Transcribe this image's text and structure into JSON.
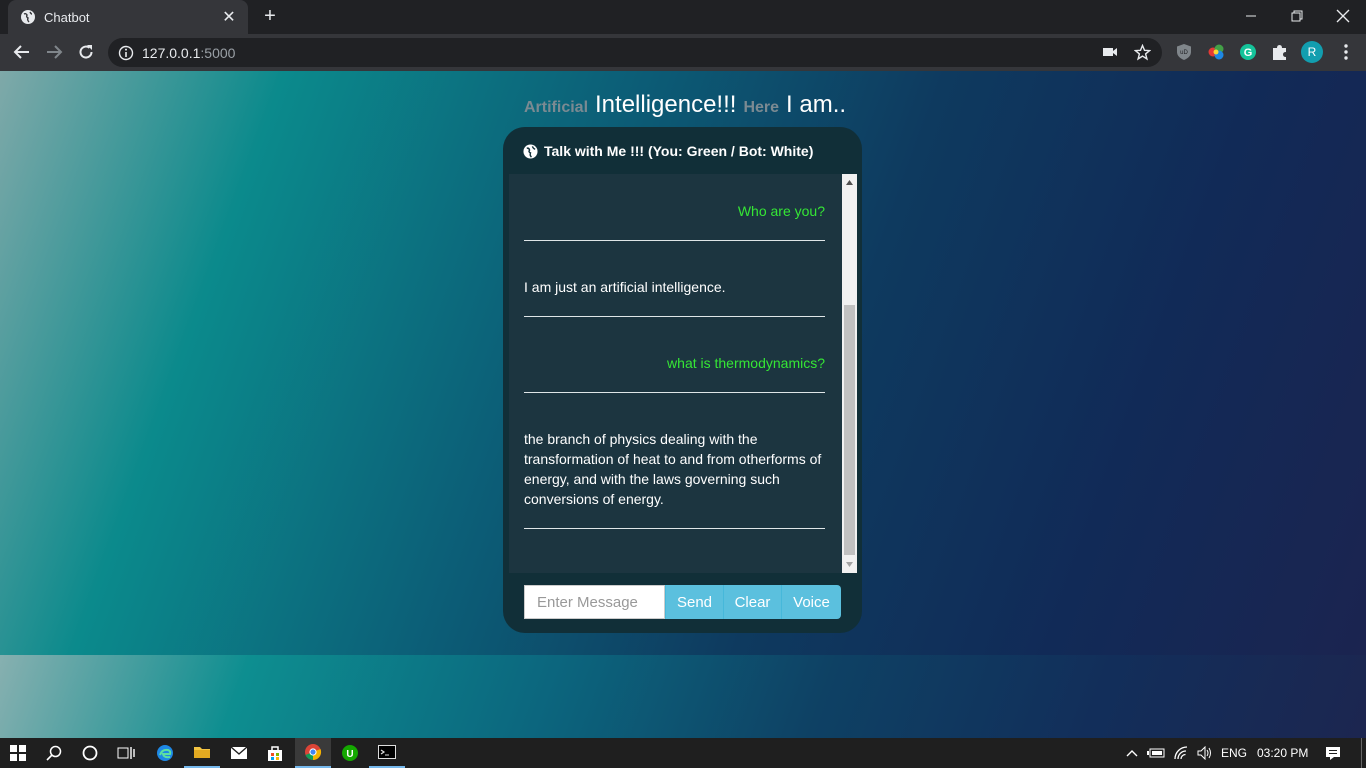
{
  "browser": {
    "tab_title": "Chatbot",
    "url_host": "127.0.0.1",
    "url_port": ":5000",
    "profile_initial": "R"
  },
  "page": {
    "headline": {
      "word1": "Artificial",
      "word2": "Intelligence!!!",
      "word3": "Here",
      "word4": "I am.."
    },
    "chat": {
      "header": "Talk with Me !!! (You: Green / Bot: White)",
      "messages": [
        {
          "sender": "user",
          "text": "Who are you?"
        },
        {
          "sender": "bot",
          "text": "I am just an artificial intelligence."
        },
        {
          "sender": "user",
          "text": "what is thermodynamics?"
        },
        {
          "sender": "bot",
          "text": "the branch of physics dealing with the transformation of heat to and from otherforms of energy, and with the laws governing such conversions of energy."
        }
      ],
      "input_placeholder": "Enter Message",
      "send_label": "Send",
      "clear_label": "Clear",
      "voice_label": "Voice"
    }
  },
  "taskbar": {
    "language": "ENG",
    "time": "03:20 PM"
  },
  "colors": {
    "user_message": "#35e635",
    "bot_message": "#ffffff",
    "button": "#5bc0de",
    "chat_panel": "#112f38"
  }
}
